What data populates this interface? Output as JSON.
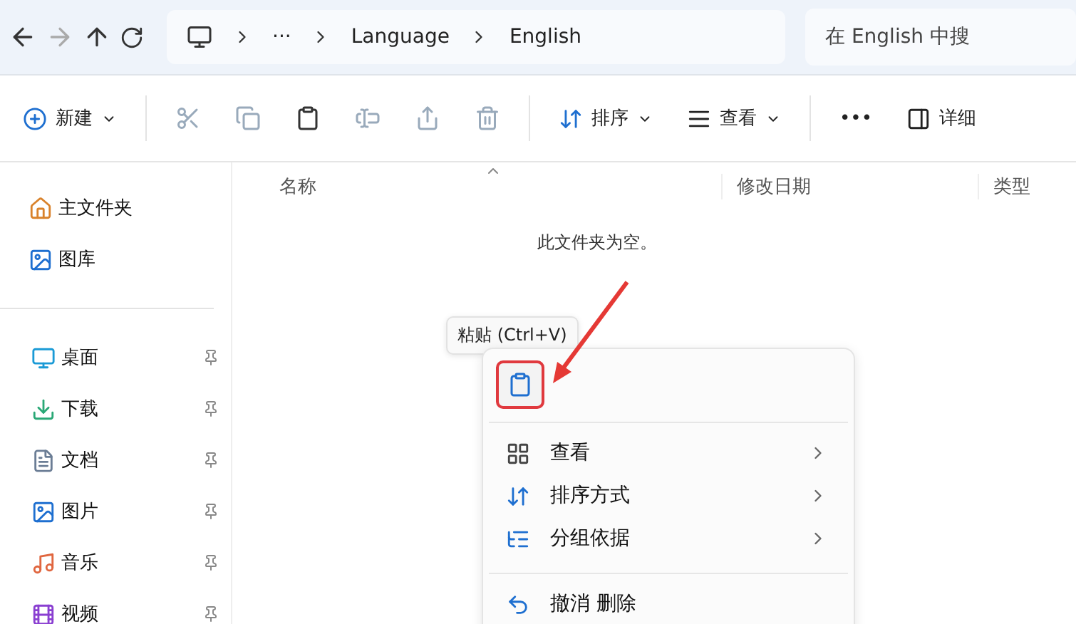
{
  "breadcrumb": [
    "···",
    "Language",
    "English"
  ],
  "search": {
    "placeholder": "在 English 中搜"
  },
  "toolbar": {
    "new_label": "新建",
    "sort_label": "排序",
    "view_label": "查看",
    "more_label": "•••",
    "details_label": "详细"
  },
  "sidebar": {
    "top_items": [
      {
        "label": "主文件夹",
        "kind": "home"
      },
      {
        "label": "图库",
        "kind": "gallery"
      }
    ],
    "pinned_items": [
      {
        "label": "桌面",
        "kind": "desktop"
      },
      {
        "label": "下载",
        "kind": "download"
      },
      {
        "label": "文档",
        "kind": "document"
      },
      {
        "label": "图片",
        "kind": "picture"
      },
      {
        "label": "音乐",
        "kind": "music"
      },
      {
        "label": "视频",
        "kind": "video"
      }
    ]
  },
  "columns": [
    "名称",
    "修改日期",
    "类型"
  ],
  "empty_message": "此文件夹为空。",
  "tooltip": "粘贴 (Ctrl+V)",
  "context_menu": {
    "items": [
      {
        "label": "查看",
        "kind": "view"
      },
      {
        "label": "排序方式",
        "kind": "sort"
      },
      {
        "label": "分组依据",
        "kind": "group"
      }
    ],
    "cut_item": "撤消 删除"
  }
}
